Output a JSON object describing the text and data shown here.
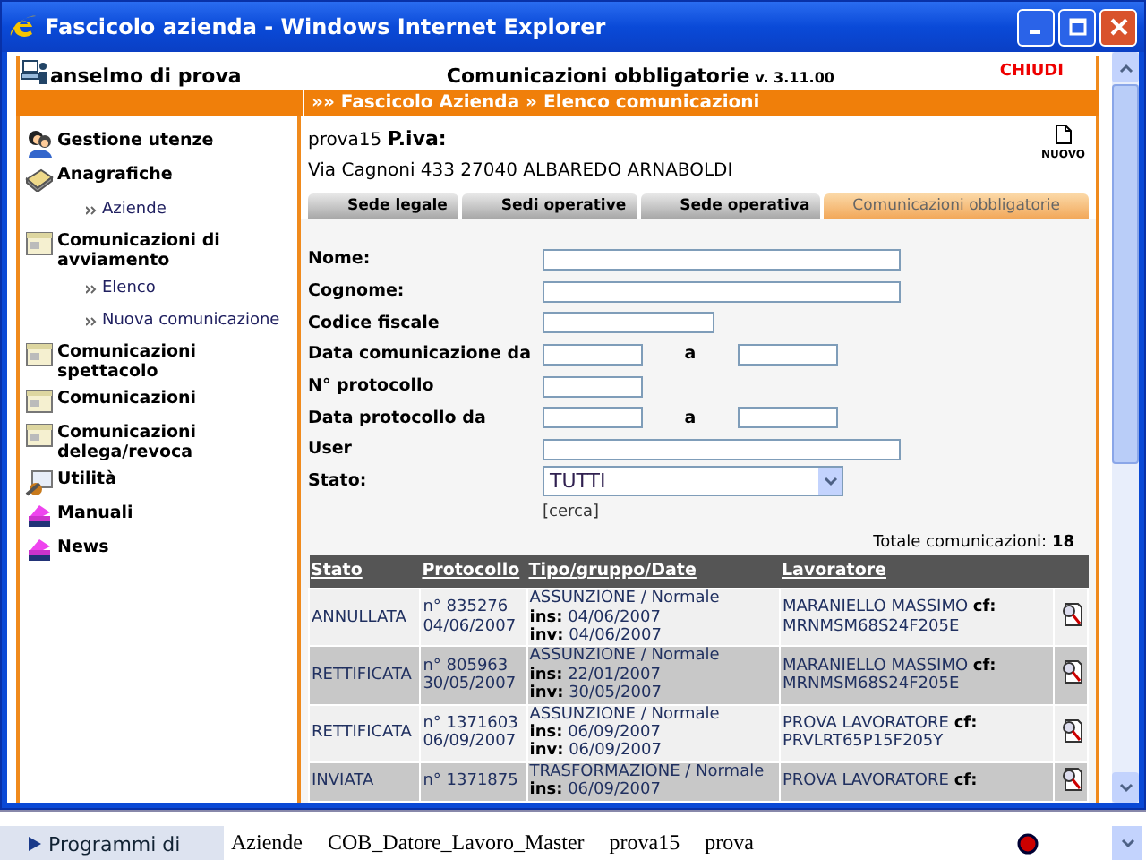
{
  "window": {
    "title": "Fascicolo azienda - Windows Internet Explorer"
  },
  "header": {
    "user": "anselmo di prova",
    "app_title": "Comunicazioni obbligatorie",
    "version": "v. 3.11.00",
    "close_label": "CHIUDI"
  },
  "breadcrumb": "»» Fascicolo Azienda » Elenco comunicazioni",
  "sidebar": {
    "items": [
      {
        "label": "Gestione utenze"
      },
      {
        "label": "Anagrafiche",
        "children": [
          {
            "label": "Aziende"
          }
        ]
      },
      {
        "label": "Comunicazioni di avviamento",
        "children": [
          {
            "label": "Elenco"
          },
          {
            "label": "Nuova comunicazione"
          }
        ]
      },
      {
        "label": "Comunicazioni spettacolo"
      },
      {
        "label": "Comunicazioni"
      },
      {
        "label": "Comunicazioni delega/revoca"
      },
      {
        "label": "Utilità"
      },
      {
        "label": "Manuali"
      },
      {
        "label": "News"
      }
    ]
  },
  "company": {
    "name": "prova15",
    "piva_label": "P.iva:",
    "address": "Via Cagnoni 433 27040 ALBAREDO ARNABOLDI",
    "new_label": "NUOVO"
  },
  "tabs": [
    {
      "label": "Sede legale",
      "selected": false
    },
    {
      "label": "Sedi operative",
      "selected": false
    },
    {
      "label": "Sede operativa",
      "selected": false
    },
    {
      "label": "Comunicazioni obbligatorie",
      "selected": true
    }
  ],
  "form": {
    "fields": [
      {
        "kind": "wide",
        "label": "Nome:"
      },
      {
        "kind": "wide",
        "label": "Cognome:"
      },
      {
        "kind": "medium",
        "label": "Codice fiscale"
      },
      {
        "kind": "range",
        "label": "Data comunicazione da",
        "to_label": "a"
      },
      {
        "kind": "narrow",
        "label": "N° protocollo"
      },
      {
        "kind": "range",
        "label": "Data protocollo da",
        "to_label": "a"
      },
      {
        "kind": "wide",
        "label": "User"
      },
      {
        "kind": "select",
        "label": "Stato:",
        "value": "TUTTI"
      }
    ],
    "search_link": "[cerca]"
  },
  "total": {
    "label": "Totale comunicazioni:",
    "value": "18"
  },
  "table": {
    "columns": [
      "Stato",
      "Protocollo",
      "Tipo/gruppo/Date",
      "Lavoratore"
    ],
    "rows": [
      {
        "stato": "ANNULLATA",
        "protocollo": [
          "n° 835276",
          "04/06/2007"
        ],
        "tipo": "ASSUNZIONE / Normale",
        "dates": [
          "**ins:** 04/06/2007",
          "**inv:** 04/06/2007"
        ],
        "lavoratore": "MARANIELLO MASSIMO **cf:** MRNMSM68S24F205E"
      },
      {
        "stato": "RETTIFICATA",
        "protocollo": [
          "n° 805963",
          "30/05/2007"
        ],
        "tipo": "ASSUNZIONE / Normale",
        "dates": [
          "**ins:** 22/01/2007",
          "**inv:** 30/05/2007"
        ],
        "lavoratore": "MARANIELLO MASSIMO **cf:** MRNMSM68S24F205E"
      },
      {
        "stato": "RETTIFICATA",
        "protocollo": [
          "n° 1371603",
          "06/09/2007"
        ],
        "tipo": "ASSUNZIONE / Normale",
        "dates": [
          "**ins:** 06/09/2007",
          "**inv:** 06/09/2007"
        ],
        "lavoratore": "PROVA LAVORATORE **cf:** PRVLRT65P15F205Y"
      },
      {
        "stato": "INVIATA",
        "protocollo": [
          "n° 1371875"
        ],
        "tipo": "TRASFORMAZIONE / Normale",
        "dates": [
          "**ins:** 06/09/2007"
        ],
        "lavoratore": "PROVA LAVORATORE **cf:**"
      }
    ]
  },
  "background_window": {
    "nav_item": "Programmi di",
    "cells": [
      "Aziende",
      "COB_Datore_Lavoro_Master",
      "prova15",
      "prova"
    ]
  }
}
